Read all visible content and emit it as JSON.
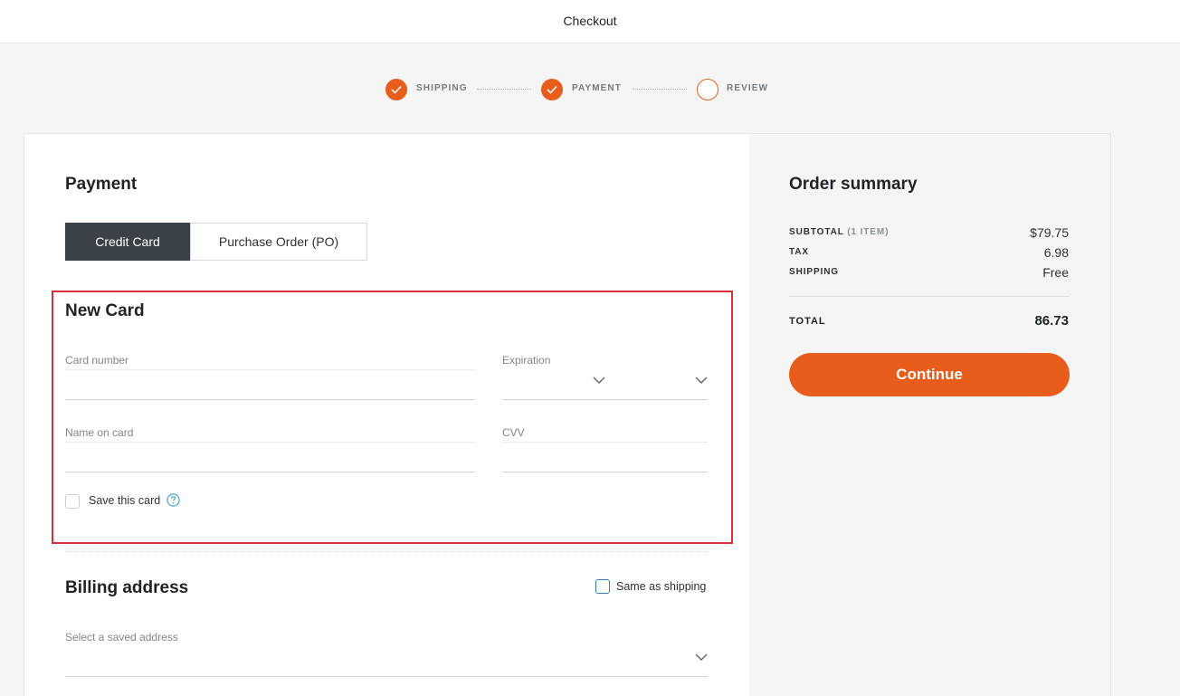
{
  "header": {
    "title": "Checkout"
  },
  "steps": [
    {
      "label": "SHIPPING",
      "status": "complete"
    },
    {
      "label": "PAYMENT",
      "status": "complete"
    },
    {
      "label": "REVIEW",
      "status": "pending"
    }
  ],
  "payment": {
    "title": "Payment",
    "methods": [
      {
        "label": "Credit Card",
        "selected": true
      },
      {
        "label": "Purchase Order (PO)",
        "selected": false
      }
    ]
  },
  "new_card": {
    "title": "New Card",
    "card_number_label": "Card number",
    "card_number_value": "",
    "expiration_label": "Expiration",
    "expiration_month_value": "",
    "expiration_year_value": "",
    "name_label": "Name on card",
    "name_value": "",
    "cvv_label": "CVV",
    "cvv_value": "",
    "save_card_label": "Save this card",
    "save_card_checked": false
  },
  "billing": {
    "title": "Billing address",
    "same_as_shipping_label": "Same as shipping",
    "same_as_shipping_checked": false,
    "saved_address_label": "Select a saved address",
    "saved_address_value": ""
  },
  "summary": {
    "title": "Order summary",
    "subtotal_label": "SUBTOTAL",
    "subtotal_count": "(1 ITEM)",
    "subtotal_value": "$79.75",
    "tax_label": "TAX",
    "tax_value": "6.98",
    "shipping_label": "SHIPPING",
    "shipping_value": "Free",
    "total_label": "TOTAL",
    "total_value": "86.73",
    "continue_label": "Continue"
  },
  "colors": {
    "accent": "#e95d1c",
    "dark_tab": "#3b4148",
    "highlight": "#d92e35",
    "info_blue": "#2f7fb8"
  },
  "icons": {
    "step_complete": "checkmark-icon",
    "dropdown": "chevron-down-icon",
    "help": "question-circle-icon"
  }
}
